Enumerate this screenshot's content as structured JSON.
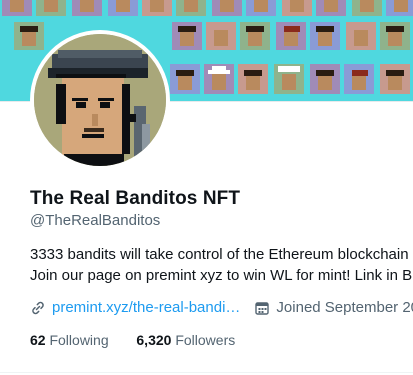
{
  "profile": {
    "display_name": "The Real Banditos NFT",
    "handle": "@TheRealBanditos",
    "bio_line1": "3333 bandits will take control of the Ethereum blockchain",
    "bio_line2": "Join our page on premint xyz to win WL for mint! Link in Bi",
    "link_text": "premint.xyz/the-real-bandi…",
    "joined_text": "Joined September 20",
    "following_count": "62",
    "following_label": "Following",
    "followers_count": "6,320",
    "followers_label": "Followers"
  },
  "icons": {
    "link": "link-icon",
    "calendar": "calendar-icon"
  },
  "colors": {
    "banner": "#4fd8df",
    "link": "#1d9bf0",
    "secondary_text": "#536471",
    "primary_text": "#0f1419",
    "avatar_bg": "#a9a77a"
  }
}
